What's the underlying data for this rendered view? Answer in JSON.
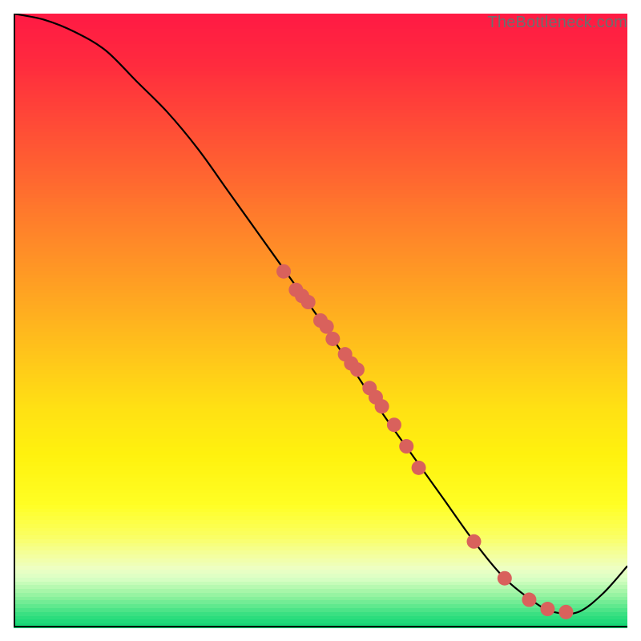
{
  "watermark": "TheBottleneck.com",
  "chart_data": {
    "type": "line",
    "title": "",
    "xlabel": "",
    "ylabel": "",
    "xlim": [
      0,
      100
    ],
    "ylim": [
      0,
      100
    ],
    "grid": false,
    "series": [
      {
        "name": "curve",
        "x": [
          0,
          5,
          10,
          15,
          20,
          25,
          30,
          35,
          40,
          45,
          50,
          55,
          60,
          65,
          70,
          75,
          80,
          85,
          88,
          92,
          96,
          100
        ],
        "values": [
          100,
          99,
          97,
          94,
          89,
          84,
          78,
          71,
          64,
          57,
          50,
          42.5,
          35,
          28,
          21,
          14,
          8,
          4,
          2.5,
          2.5,
          5.5,
          10
        ]
      }
    ],
    "points": {
      "name": "dots",
      "x": [
        44,
        46,
        47,
        48,
        50,
        51,
        52,
        54,
        55,
        56,
        58,
        59,
        60,
        62,
        64,
        66,
        75,
        80,
        84,
        87,
        90
      ],
      "values": [
        58,
        55,
        54,
        53,
        50,
        49,
        47,
        44.5,
        43,
        42,
        39,
        37.5,
        36,
        33,
        29.5,
        26,
        14,
        8,
        4.5,
        3,
        2.5
      ]
    },
    "background_gradient": {
      "top_color": "#ff1a44",
      "stops": [
        {
          "pos": 0.0,
          "color": "#ff1a44"
        },
        {
          "pos": 0.08,
          "color": "#ff2a3e"
        },
        {
          "pos": 0.16,
          "color": "#ff4438"
        },
        {
          "pos": 0.24,
          "color": "#ff5e32"
        },
        {
          "pos": 0.32,
          "color": "#ff782c"
        },
        {
          "pos": 0.4,
          "color": "#ff9226"
        },
        {
          "pos": 0.48,
          "color": "#ffac20"
        },
        {
          "pos": 0.56,
          "color": "#ffc61a"
        },
        {
          "pos": 0.64,
          "color": "#ffe014"
        },
        {
          "pos": 0.72,
          "color": "#fff20e"
        },
        {
          "pos": 0.8,
          "color": "#ffff24"
        },
        {
          "pos": 0.85,
          "color": "#fbff60"
        },
        {
          "pos": 0.88,
          "color": "#f4ff9a"
        },
        {
          "pos": 0.905,
          "color": "#edffc4"
        },
        {
          "pos": 0.92,
          "color": "#d9ffc4"
        },
        {
          "pos": 0.935,
          "color": "#b6f9b0"
        },
        {
          "pos": 0.95,
          "color": "#8ff29e"
        },
        {
          "pos": 0.965,
          "color": "#62e98f"
        },
        {
          "pos": 0.98,
          "color": "#34df80"
        },
        {
          "pos": 1.0,
          "color": "#10d674"
        }
      ]
    },
    "axis_color": "#000000",
    "curve_color": "#000000",
    "point_color": "#d9615c",
    "point_radius": 9
  }
}
